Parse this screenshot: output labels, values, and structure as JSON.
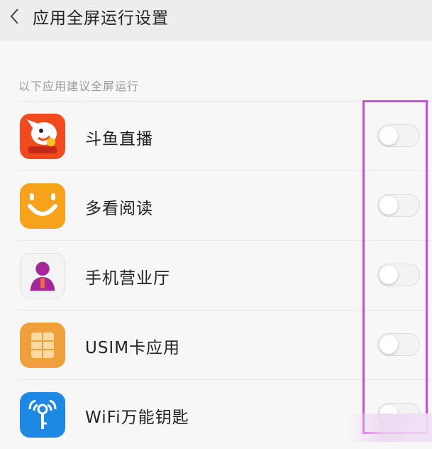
{
  "header": {
    "title": "应用全屏运行设置",
    "back_icon": "chevron-left-icon"
  },
  "section": {
    "label": "以下应用建议全屏运行"
  },
  "apps": [
    {
      "name": "斗鱼直播",
      "icon": "douyu-icon",
      "enabled": false
    },
    {
      "name": "多看阅读",
      "icon": "duokan-icon",
      "enabled": false
    },
    {
      "name": "手机营业厅",
      "icon": "business-hall-icon",
      "enabled": false
    },
    {
      "name": "USIM卡应用",
      "icon": "sim-card-icon",
      "enabled": false
    },
    {
      "name": "WiFi万能钥匙",
      "icon": "wifi-key-icon",
      "enabled": false
    }
  ],
  "colors": {
    "highlight": "#d84adf",
    "douyu": "#f04a1e",
    "duokan": "#f7a21b",
    "sim": "#eea03a",
    "wifi": "#1e88e5"
  }
}
